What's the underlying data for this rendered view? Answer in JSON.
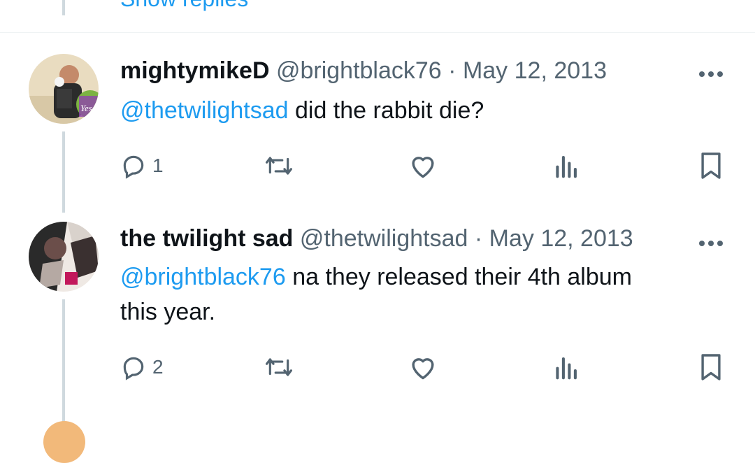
{
  "top": {
    "show_replies": "Show replies"
  },
  "tweets": [
    {
      "name": "mightymikeD",
      "handle": "@brightblack76",
      "date": "May 12, 2013",
      "separator": "·",
      "mention": "@thetwilightsad",
      "text": " did the rabbit die?",
      "avatar_badge": "Yes",
      "reply_count": "1"
    },
    {
      "name": "the twilight sad",
      "handle": "@thetwilightsad",
      "date": "May 12, 2013",
      "separator": "·",
      "mention": "@brightblack76",
      "text_line1": " na they released their 4th album",
      "text_line2": "this year.",
      "reply_count": "2"
    }
  ],
  "icons": {
    "reply": "reply-icon",
    "retweet": "retweet-icon",
    "like": "heart-icon",
    "views": "views-icon",
    "bookmark": "bookmark-icon",
    "more": "more-icon"
  },
  "colors": {
    "accent": "#1d9bf0",
    "secondary_text": "#536471",
    "thread_line": "#cfd9de",
    "primary_text": "#0f1419"
  }
}
